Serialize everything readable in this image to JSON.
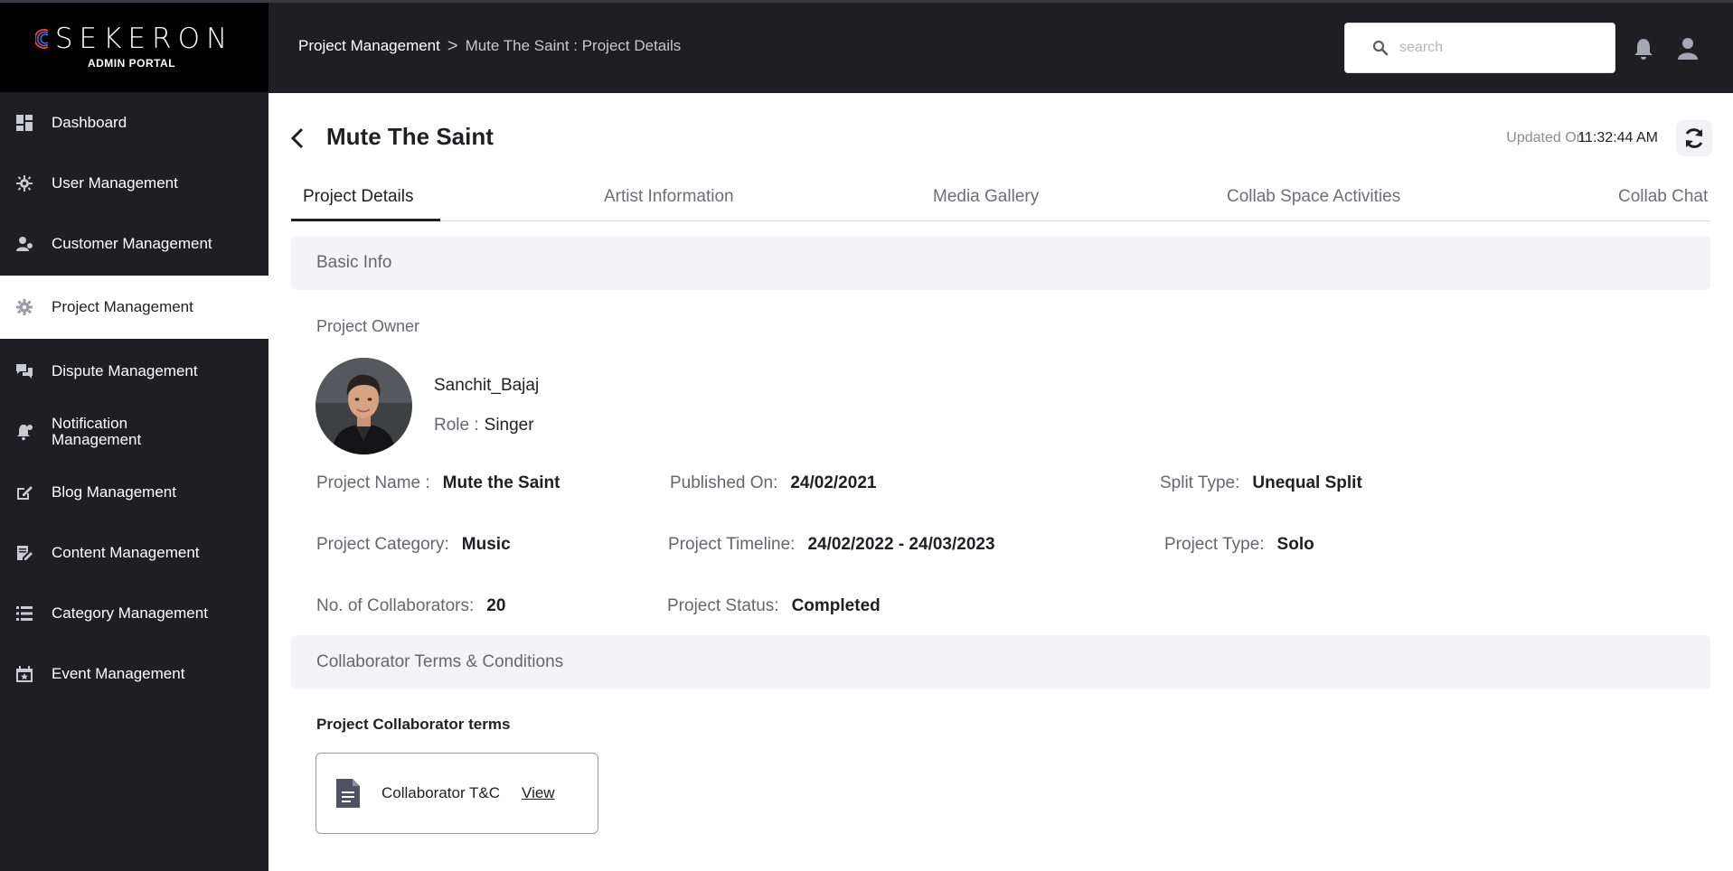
{
  "brand": {
    "name": "SEKERON",
    "subtitle": "ADMIN PORTAL"
  },
  "sidebar": {
    "items": [
      {
        "label": "Dashboard",
        "icon": "dashboard-icon"
      },
      {
        "label": "User Management",
        "icon": "user-gear-icon"
      },
      {
        "label": "Customer Management",
        "icon": "customer-icon"
      },
      {
        "label": "Project Management",
        "icon": "gear-icon",
        "active": true
      },
      {
        "label": "Dispute Management",
        "icon": "chat-bubbles-icon"
      },
      {
        "label": "Notification Management",
        "icon": "bell-gear-icon"
      },
      {
        "label": "Blog Management",
        "icon": "blog-icon"
      },
      {
        "label": "Content Management",
        "icon": "document-edit-icon"
      },
      {
        "label": "Category Management",
        "icon": "list-icon"
      },
      {
        "label": "Event Management",
        "icon": "calendar-icon"
      }
    ]
  },
  "header": {
    "breadcrumb_root": "Project Management",
    "breadcrumb_sep": ">",
    "breadcrumb_current": "Mute The Saint : Project Details",
    "search_placeholder": "search"
  },
  "project": {
    "title": "Mute The Saint",
    "updated_label": "Updated On:",
    "updated_time": "11:32:44 AM"
  },
  "tabs": [
    "Project Details",
    "Artist Information",
    "Media Gallery",
    "Collab Space Activities",
    "Collab Chat"
  ],
  "basic_info": {
    "heading": "Basic Info",
    "owner_label": "Project Owner",
    "owner_name": "Sanchit_Bajaj",
    "role_label": "Role :",
    "role_value": "Singer",
    "fields": {
      "project_name": {
        "label": "Project Name :",
        "value": "Mute the Saint"
      },
      "published_on": {
        "label": "Published On:",
        "value": "24/02/2021"
      },
      "split_type": {
        "label": "Split Type:",
        "value": "Unequal Split"
      },
      "project_category": {
        "label": "Project Category:",
        "value": "Music"
      },
      "project_timeline": {
        "label": "Project Timeline:",
        "value": "24/02/2022 - 24/03/2023"
      },
      "project_type": {
        "label": "Project Type:",
        "value": "Solo"
      },
      "collaborators": {
        "label": "No. of Collaborators:",
        "value": "20"
      },
      "project_status": {
        "label": "Project Status:",
        "value": "Completed"
      }
    }
  },
  "terms": {
    "heading": "Collaborator Terms & Conditions",
    "sub_label": "Project Collaborator terms",
    "card_name": "Collaborator T&C",
    "view_label": "View"
  },
  "colors": {
    "sidebar_bg": "#1f1e23",
    "header_bg": "#1f1e23",
    "section_bg": "#f4f4f8",
    "accent": "#1f1f24"
  }
}
